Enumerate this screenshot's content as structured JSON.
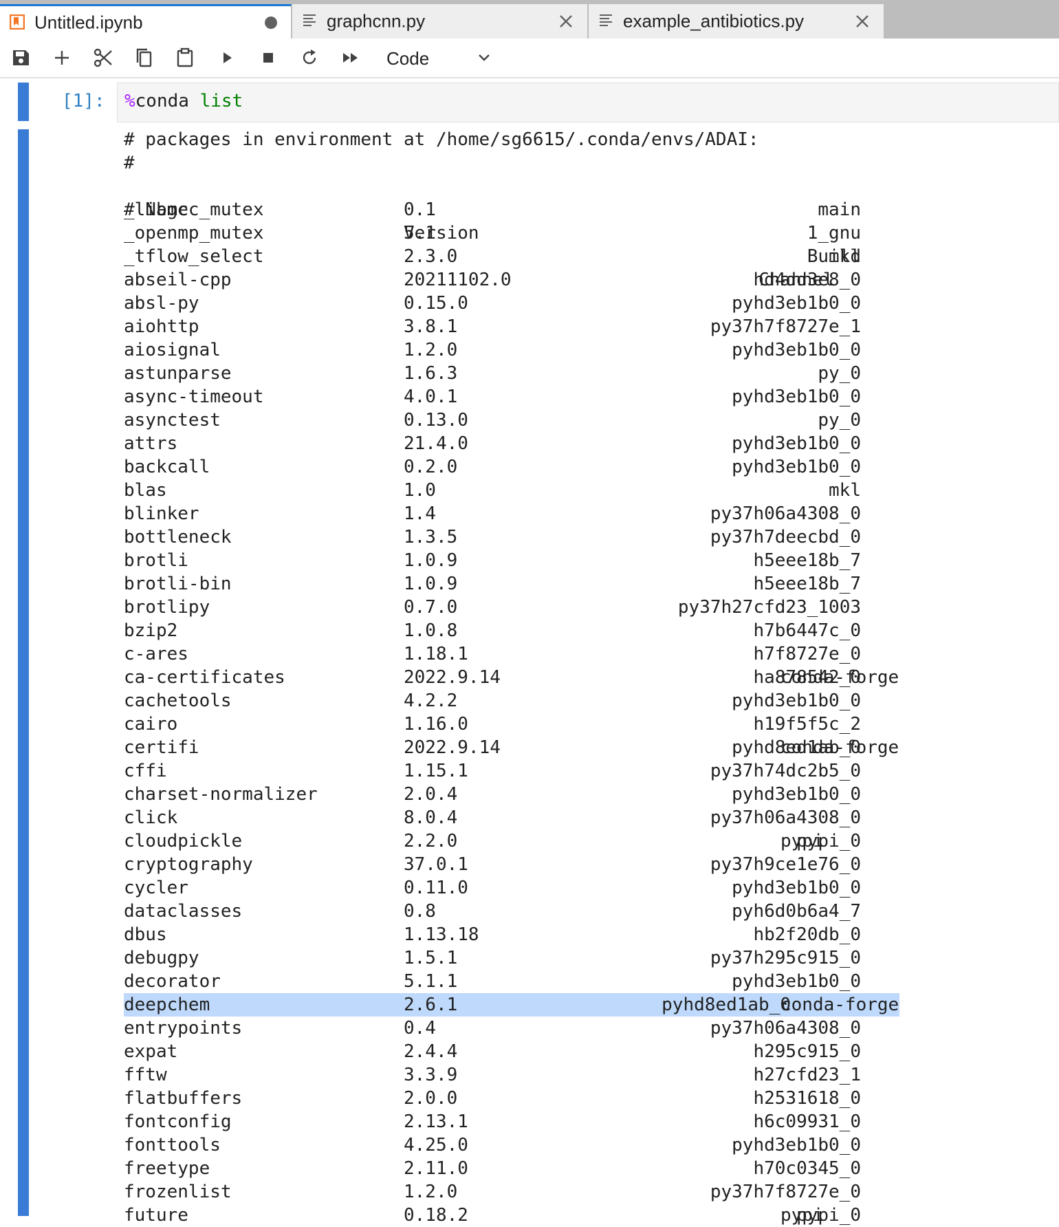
{
  "tabs": [
    {
      "label": "Untitled.ipynb",
      "icon": "notebook-icon",
      "active": true,
      "dirty": true
    },
    {
      "label": "graphcnn.py",
      "icon": "text-file-icon",
      "active": false
    },
    {
      "label": "example_antibiotics.py",
      "icon": "text-file-icon",
      "active": false
    }
  ],
  "toolbar": {
    "buttons": [
      "save-icon",
      "add-cell-icon",
      "cut-icon",
      "copy-icon",
      "paste-icon",
      "run-icon",
      "stop-icon",
      "restart-icon",
      "run-all-icon"
    ],
    "cell_type": "Code"
  },
  "cell": {
    "prompt": "[1]:",
    "magic": "%",
    "command": "conda",
    "arg": "list"
  },
  "output": {
    "intro": "# packages in environment at /home/sg6615/.conda/envs/ADAI:",
    "hash": "#",
    "header": {
      "name": "# Name",
      "version": "Version",
      "build": "Build",
      "channel": "Channel"
    },
    "highlight_row": "deepchem",
    "rows": [
      {
        "name": "_libgcc_mutex",
        "version": "0.1",
        "build": "main",
        "channel": ""
      },
      {
        "name": "_openmp_mutex",
        "version": "5.1",
        "build": "1_gnu",
        "channel": ""
      },
      {
        "name": "_tflow_select",
        "version": "2.3.0",
        "build": "mkl",
        "channel": ""
      },
      {
        "name": "abseil-cpp",
        "version": "20211102.0",
        "build": "hd4dd3e8_0",
        "channel": ""
      },
      {
        "name": "absl-py",
        "version": "0.15.0",
        "build": "pyhd3eb1b0_0",
        "channel": ""
      },
      {
        "name": "aiohttp",
        "version": "3.8.1",
        "build": "py37h7f8727e_1",
        "channel": ""
      },
      {
        "name": "aiosignal",
        "version": "1.2.0",
        "build": "pyhd3eb1b0_0",
        "channel": ""
      },
      {
        "name": "astunparse",
        "version": "1.6.3",
        "build": "py_0",
        "channel": ""
      },
      {
        "name": "async-timeout",
        "version": "4.0.1",
        "build": "pyhd3eb1b0_0",
        "channel": ""
      },
      {
        "name": "asynctest",
        "version": "0.13.0",
        "build": "py_0",
        "channel": ""
      },
      {
        "name": "attrs",
        "version": "21.4.0",
        "build": "pyhd3eb1b0_0",
        "channel": ""
      },
      {
        "name": "backcall",
        "version": "0.2.0",
        "build": "pyhd3eb1b0_0",
        "channel": ""
      },
      {
        "name": "blas",
        "version": "1.0",
        "build": "mkl",
        "channel": ""
      },
      {
        "name": "blinker",
        "version": "1.4",
        "build": "py37h06a4308_0",
        "channel": ""
      },
      {
        "name": "bottleneck",
        "version": "1.3.5",
        "build": "py37h7deecbd_0",
        "channel": ""
      },
      {
        "name": "brotli",
        "version": "1.0.9",
        "build": "h5eee18b_7",
        "channel": ""
      },
      {
        "name": "brotli-bin",
        "version": "1.0.9",
        "build": "h5eee18b_7",
        "channel": ""
      },
      {
        "name": "brotlipy",
        "version": "0.7.0",
        "build": "py37h27cfd23_1003",
        "channel": ""
      },
      {
        "name": "bzip2",
        "version": "1.0.8",
        "build": "h7b6447c_0",
        "channel": ""
      },
      {
        "name": "c-ares",
        "version": "1.18.1",
        "build": "h7f8727e_0",
        "channel": ""
      },
      {
        "name": "ca-certificates",
        "version": "2022.9.14",
        "build": "ha878542_0",
        "channel": "conda-forge"
      },
      {
        "name": "cachetools",
        "version": "4.2.2",
        "build": "pyhd3eb1b0_0",
        "channel": ""
      },
      {
        "name": "cairo",
        "version": "1.16.0",
        "build": "h19f5f5c_2",
        "channel": ""
      },
      {
        "name": "certifi",
        "version": "2022.9.14",
        "build": "pyhd8ed1ab_0",
        "channel": "conda-forge"
      },
      {
        "name": "cffi",
        "version": "1.15.1",
        "build": "py37h74dc2b5_0",
        "channel": ""
      },
      {
        "name": "charset-normalizer",
        "version": "2.0.4",
        "build": "pyhd3eb1b0_0",
        "channel": ""
      },
      {
        "name": "click",
        "version": "8.0.4",
        "build": "py37h06a4308_0",
        "channel": ""
      },
      {
        "name": "cloudpickle",
        "version": "2.2.0",
        "build": "pypi_0",
        "channel": "pypi"
      },
      {
        "name": "cryptography",
        "version": "37.0.1",
        "build": "py37h9ce1e76_0",
        "channel": ""
      },
      {
        "name": "cycler",
        "version": "0.11.0",
        "build": "pyhd3eb1b0_0",
        "channel": ""
      },
      {
        "name": "dataclasses",
        "version": "0.8",
        "build": "pyh6d0b6a4_7",
        "channel": ""
      },
      {
        "name": "dbus",
        "version": "1.13.18",
        "build": "hb2f20db_0",
        "channel": ""
      },
      {
        "name": "debugpy",
        "version": "1.5.1",
        "build": "py37h295c915_0",
        "channel": ""
      },
      {
        "name": "decorator",
        "version": "5.1.1",
        "build": "pyhd3eb1b0_0",
        "channel": ""
      },
      {
        "name": "deepchem",
        "version": "2.6.1",
        "build": "pyhd8ed1ab_0",
        "channel": "conda-forge"
      },
      {
        "name": "entrypoints",
        "version": "0.4",
        "build": "py37h06a4308_0",
        "channel": ""
      },
      {
        "name": "expat",
        "version": "2.4.4",
        "build": "h295c915_0",
        "channel": ""
      },
      {
        "name": "fftw",
        "version": "3.3.9",
        "build": "h27cfd23_1",
        "channel": ""
      },
      {
        "name": "flatbuffers",
        "version": "2.0.0",
        "build": "h2531618_0",
        "channel": ""
      },
      {
        "name": "fontconfig",
        "version": "2.13.1",
        "build": "h6c09931_0",
        "channel": ""
      },
      {
        "name": "fonttools",
        "version": "4.25.0",
        "build": "pyhd3eb1b0_0",
        "channel": ""
      },
      {
        "name": "freetype",
        "version": "2.11.0",
        "build": "h70c0345_0",
        "channel": ""
      },
      {
        "name": "frozenlist",
        "version": "1.2.0",
        "build": "py37h7f8727e_0",
        "channel": ""
      },
      {
        "name": "future",
        "version": "0.18.2",
        "build": "pypi_0",
        "channel": "pypi"
      }
    ]
  },
  "colors": {
    "accent": "#1976d2",
    "collapser": "#3a7bd5",
    "prompt": "#307fc1",
    "highlight": "#bed9fb",
    "magic": "#aa22ff",
    "keyword": "#008000"
  }
}
